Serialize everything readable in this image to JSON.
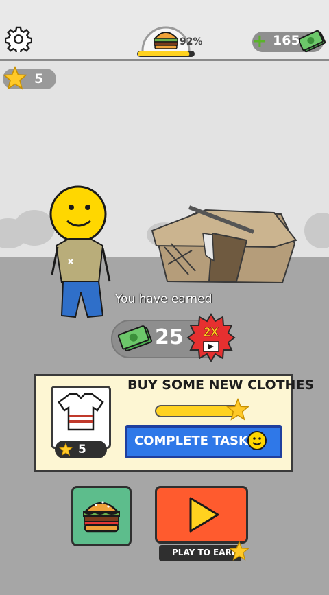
{
  "topbar": {
    "hunger_percent": "92%",
    "hunger_level": 0.92,
    "money": "165",
    "money_add_symbol": "+"
  },
  "stars": {
    "count": "5"
  },
  "earnings": {
    "label": "You have earned",
    "amount": "25",
    "multiplier": "2X"
  },
  "task": {
    "title": "BUY SOME NEW CLOTHES",
    "reward": "5",
    "progress": 1.0,
    "button_label": "COMPLETE TASK"
  },
  "actions": {
    "play_label": "PLAY TO EARN"
  },
  "colors": {
    "money_green": "#5ab329",
    "complete_blue": "#2f78e8",
    "play_orange": "#ff5b2e",
    "food_green": "#5dbd8c",
    "panel_cream": "#fdf6d3",
    "star_yellow": "#ffd21f"
  },
  "icons": [
    "gear-icon",
    "burger-icon",
    "cash-icon",
    "star-icon",
    "shirt-icon",
    "video-icon",
    "smiley-icon",
    "play-icon"
  ]
}
